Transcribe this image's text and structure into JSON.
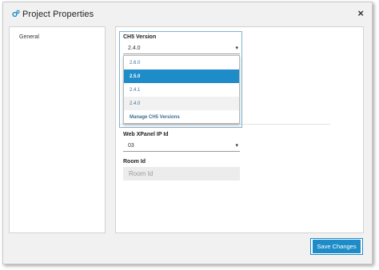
{
  "window": {
    "title": "Project Properties",
    "close_glyph": "×",
    "app_icon": "gear-cluster-icon"
  },
  "sidebar": {
    "items": [
      {
        "label": "General"
      }
    ]
  },
  "ch5_version": {
    "label": "CH5 Version",
    "value": "2.4.0",
    "options": [
      "2.6.0",
      "2.5.0",
      "2.4.1",
      "2.4.0"
    ],
    "highlighted": "2.5.0",
    "manage_label": "Manage CH5 Versions"
  },
  "web_xpanel": {
    "label": "Web XPanel IP Id",
    "value": "03"
  },
  "room_id": {
    "label": "Room Id",
    "placeholder": "Room Id",
    "value": ""
  },
  "footer": {
    "save_label": "Save Changes"
  },
  "colors": {
    "accent": "#1e8cc8",
    "link": "#3d6f93",
    "dialog_bg": "#f1f1f1"
  }
}
